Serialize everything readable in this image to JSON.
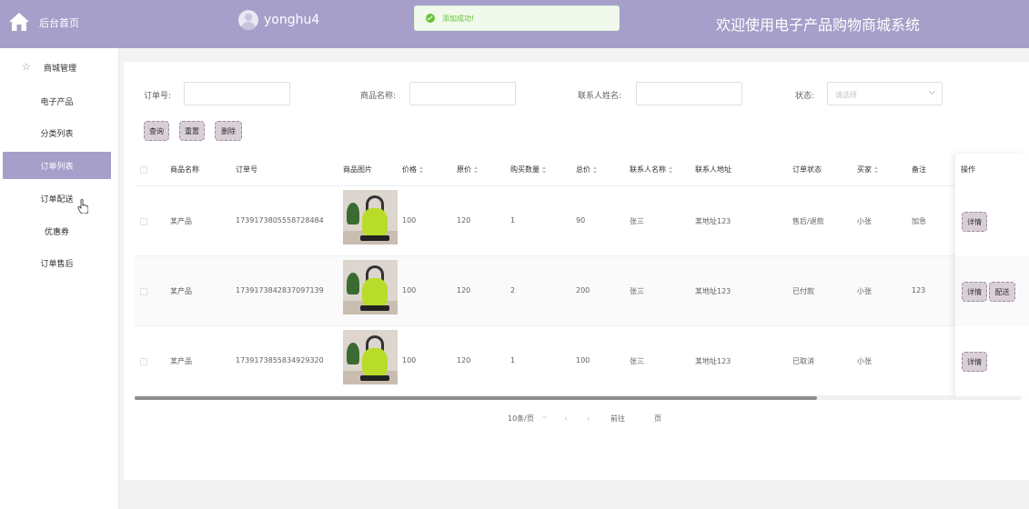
{
  "header": {
    "home_label": "后台首页",
    "username": "yonghu4",
    "site_title": "欢迎使用电子产品购物商城系统"
  },
  "toast": {
    "message": "添加成功!"
  },
  "sidebar": {
    "group_label": "商城管理",
    "items": [
      {
        "label": "电子产品"
      },
      {
        "label": "分类列表"
      },
      {
        "label": "订单列表"
      },
      {
        "label": "订单配送"
      },
      {
        "label": "优惠券"
      },
      {
        "label": "订单售后"
      }
    ]
  },
  "search": {
    "order_no_label": "订单号:",
    "order_no_value": "",
    "product_name_label": "商品名称:",
    "product_name_value": "",
    "contact_label": "联系人姓名:",
    "contact_value": "",
    "status_label": "状态:",
    "status_placeholder": "请选择",
    "query_btn": "查询",
    "reset_btn": "重置",
    "delete_btn": "删除"
  },
  "table": {
    "columns": {
      "product": "商品名称",
      "order_no": "订单号",
      "image": "商品图片",
      "price": "价格",
      "original_price": "原价",
      "quantity": "购买数量",
      "total": "总价",
      "contact_name": "联系人名称",
      "address": "联系人地址",
      "status": "订单状态",
      "buyer": "买家",
      "remark": "备注",
      "ops": "操作"
    },
    "rows": [
      {
        "product": "某产品",
        "order_no": "1739173805558728484",
        "price": "100",
        "original_price": "120",
        "quantity": "1",
        "total": "90",
        "contact_name": "张三",
        "address": "某地址123",
        "status": "售后/退款",
        "buyer": "小张",
        "remark": "加急",
        "detail_btn": "详情",
        "ship_btn": ""
      },
      {
        "product": "某产品",
        "order_no": "1739173842837097139",
        "price": "100",
        "original_price": "120",
        "quantity": "2",
        "total": "200",
        "contact_name": "张三",
        "address": "某地址123",
        "status": "已付款",
        "buyer": "小张",
        "remark": "123",
        "detail_btn": "详情",
        "ship_btn": "配送"
      },
      {
        "product": "某产品",
        "order_no": "1739173855834929320",
        "price": "100",
        "original_price": "120",
        "quantity": "1",
        "total": "100",
        "contact_name": "张三",
        "address": "某地址123",
        "status": "已取消",
        "buyer": "小张",
        "remark": "",
        "detail_btn": "详情",
        "ship_btn": ""
      }
    ]
  },
  "pagination": {
    "page_size": "10条/页",
    "goto_label": "前往",
    "page_suffix": "页"
  },
  "colors": {
    "accent": "#a59fc9",
    "button_bg": "#d9cfd6",
    "success": "#67c23a"
  },
  "icons": {
    "home": "home-icon",
    "menu": "star-icon",
    "toast": "success-check-icon",
    "cursor": "hand-pointer-icon"
  }
}
